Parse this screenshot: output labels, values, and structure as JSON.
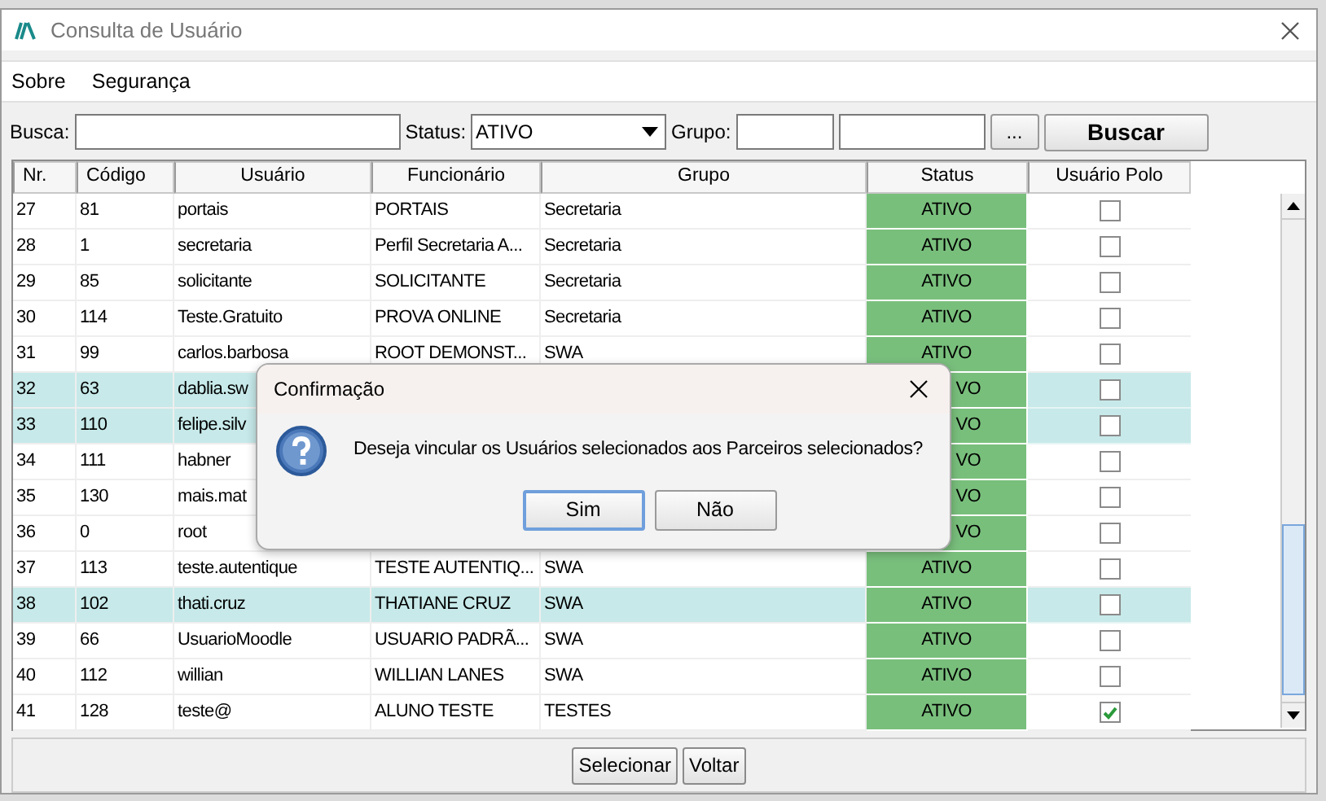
{
  "window": {
    "title": "Consulta de Usuário"
  },
  "menu": [
    {
      "label": "Sobre"
    },
    {
      "label": "Segurança"
    }
  ],
  "filters": {
    "search_label": "Busca:",
    "status_label": "Status:",
    "status_value": "ATIVO",
    "group_label": "Grupo:",
    "browse_button": "...",
    "search_button": "Buscar"
  },
  "table": {
    "columns": [
      "Nr.",
      "Código",
      "Usuário",
      "Funcionário",
      "Grupo",
      "Status",
      "Usuário Polo"
    ],
    "rows": [
      {
        "nr": "27",
        "codigo": "81",
        "usuario": "portais",
        "funcionario": "PORTAIS",
        "grupo": "Secretaria",
        "status": "ATIVO",
        "checked": false,
        "selected": false
      },
      {
        "nr": "28",
        "codigo": "1",
        "usuario": "secretaria",
        "funcionario": "Perfil Secretaria A...",
        "grupo": "Secretaria",
        "status": "ATIVO",
        "checked": false,
        "selected": false
      },
      {
        "nr": "29",
        "codigo": "85",
        "usuario": "solicitante",
        "funcionario": "SOLICITANTE",
        "grupo": "Secretaria",
        "status": "ATIVO",
        "checked": false,
        "selected": false
      },
      {
        "nr": "30",
        "codigo": "114",
        "usuario": "Teste.Gratuito",
        "funcionario": "PROVA ONLINE",
        "grupo": "Secretaria",
        "status": "ATIVO",
        "checked": false,
        "selected": false
      },
      {
        "nr": "31",
        "codigo": "99",
        "usuario": "carlos.barbosa",
        "funcionario": "ROOT DEMONST...",
        "grupo": "SWA",
        "status": "ATIVO",
        "checked": false,
        "selected": false
      },
      {
        "nr": "32",
        "codigo": "63",
        "usuario": "dablia.sw",
        "status": "VO",
        "checked": false,
        "selected": true
      },
      {
        "nr": "33",
        "codigo": "110",
        "usuario": "felipe.silv",
        "status": "VO",
        "checked": false,
        "selected": true
      },
      {
        "nr": "34",
        "codigo": "111",
        "usuario": "habner",
        "status": "VO",
        "checked": false,
        "selected": false
      },
      {
        "nr": "35",
        "codigo": "130",
        "usuario": "mais.mat",
        "status": "VO",
        "checked": false,
        "selected": false
      },
      {
        "nr": "36",
        "codigo": "0",
        "usuario": "root",
        "status": "VO",
        "checked": false,
        "selected": false
      },
      {
        "nr": "37",
        "codigo": "113",
        "usuario": "teste.autentique",
        "funcionario": "TESTE AUTENTIQ...",
        "grupo": "SWA",
        "status": "ATIVO",
        "checked": false,
        "selected": false
      },
      {
        "nr": "38",
        "codigo": "102",
        "usuario": "thati.cruz",
        "funcionario": "THATIANE CRUZ",
        "grupo": "SWA",
        "status": "ATIVO",
        "checked": false,
        "selected": true
      },
      {
        "nr": "39",
        "codigo": "66",
        "usuario": "UsuarioMoodle",
        "funcionario": "USUARIO PADRÃ...",
        "grupo": "SWA",
        "status": "ATIVO",
        "checked": false,
        "selected": false
      },
      {
        "nr": "40",
        "codigo": "112",
        "usuario": "willian",
        "funcionario": "WILLIAN LANES",
        "grupo": "SWA",
        "status": "ATIVO",
        "checked": false,
        "selected": false
      },
      {
        "nr": "41",
        "codigo": "128",
        "usuario": "teste@",
        "funcionario": "ALUNO TESTE",
        "grupo": "TESTES",
        "status": "ATIVO",
        "checked": true,
        "selected": false
      }
    ]
  },
  "dialog": {
    "title": "Confirmação",
    "message": "Deseja vincular os Usuários selecionados aos Parceiros selecionados?",
    "buttons": [
      {
        "label": "Sim",
        "selected": true
      },
      {
        "label": "Não",
        "selected": false
      }
    ]
  },
  "footer_buttons": [
    "Selecionar",
    "Voltar"
  ]
}
